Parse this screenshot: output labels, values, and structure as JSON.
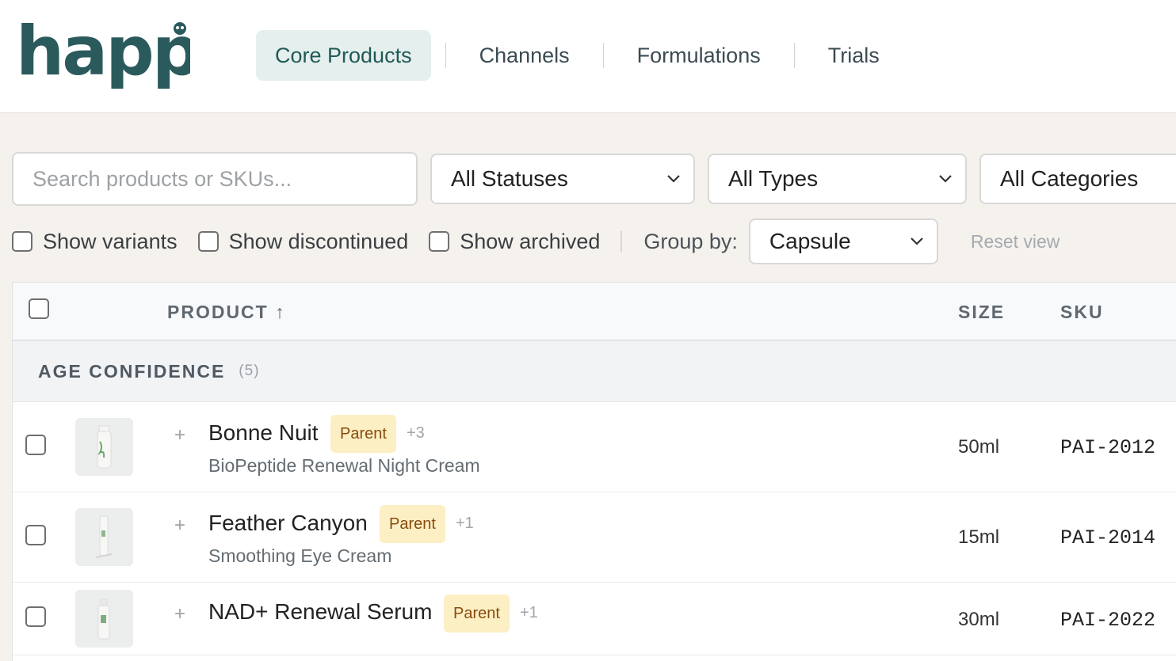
{
  "brand": {
    "logo_text": "happi",
    "color": "#2a5a5c"
  },
  "nav": {
    "tabs": [
      {
        "label": "Core Products",
        "active": true
      },
      {
        "label": "Channels",
        "active": false
      },
      {
        "label": "Formulations",
        "active": false
      },
      {
        "label": "Trials",
        "active": false
      }
    ]
  },
  "filters": {
    "search_placeholder": "Search products or SKUs...",
    "status_value": "All Statuses",
    "type_value": "All Types",
    "category_value": "All Categories",
    "show_variants": "Show variants",
    "show_discontinued": "Show discontinued",
    "show_archived": "Show archived",
    "group_by_label": "Group by:",
    "group_by_value": "Capsule",
    "reset_label": "Reset view"
  },
  "table": {
    "columns": {
      "product": "PRODUCT ↑",
      "size": "SIZE",
      "sku": "SKU"
    },
    "group": {
      "name": "AGE CONFIDENCE",
      "count": "(5)"
    },
    "rows": [
      {
        "name": "Bonne Nuit",
        "badge": "Parent",
        "variants": "+3",
        "subtitle": "BioPeptide Renewal Night Cream",
        "size": "50ml",
        "sku": "PAI-2012",
        "thumb_icon": "pump-bottle-icon"
      },
      {
        "name": "Feather Canyon",
        "badge": "Parent",
        "variants": "+1",
        "subtitle": "Smoothing Eye Cream",
        "size": "15ml",
        "sku": "PAI-2014",
        "thumb_icon": "tube-icon"
      },
      {
        "name": "NAD+ Renewal Serum",
        "badge": "Parent",
        "variants": "+1",
        "subtitle": "",
        "size": "30ml",
        "sku": "PAI-2022",
        "thumb_icon": "serum-bottle-icon"
      }
    ]
  }
}
